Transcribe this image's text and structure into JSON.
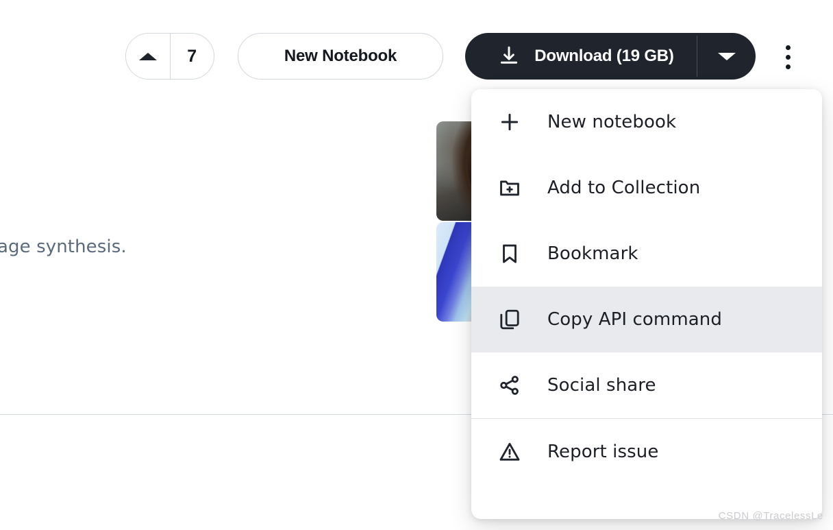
{
  "toolbar": {
    "vote": {
      "upvote_icon": "caret-up-icon",
      "count": "7"
    },
    "new_notebook_label": "New Notebook",
    "download": {
      "icon": "download-icon",
      "label": "Download (19 GB)",
      "dropdown_icon": "caret-down-icon"
    },
    "kebab_icon": "more-vertical-icon"
  },
  "content": {
    "description_fragment": "age synthesis."
  },
  "thumbnails": [
    {
      "name": "thumbnail-photo-brown-hair"
    },
    {
      "name": "thumbnail-anime-blue-hair"
    }
  ],
  "menu": {
    "items": [
      {
        "label": "New notebook",
        "icon": "plus-icon",
        "highlighted": false,
        "separator_after": false
      },
      {
        "label": "Add to Collection",
        "icon": "folder-plus-icon",
        "highlighted": false,
        "separator_after": false
      },
      {
        "label": "Bookmark",
        "icon": "bookmark-icon",
        "highlighted": false,
        "separator_after": false
      },
      {
        "label": "Copy API command",
        "icon": "copy-icon",
        "highlighted": true,
        "separator_after": false
      },
      {
        "label": "Social share",
        "icon": "share-icon",
        "highlighted": false,
        "separator_after": true
      },
      {
        "label": "Report issue",
        "icon": "warning-triangle-icon",
        "highlighted": false,
        "separator_after": false
      }
    ]
  },
  "watermark": "CSDN @TracelessLe",
  "colors": {
    "button_dark": "#20242c",
    "menu_highlight": "#e8eaee",
    "border": "#d3d7dd",
    "text_primary": "#1c2026",
    "text_muted": "#5b6b7c"
  }
}
